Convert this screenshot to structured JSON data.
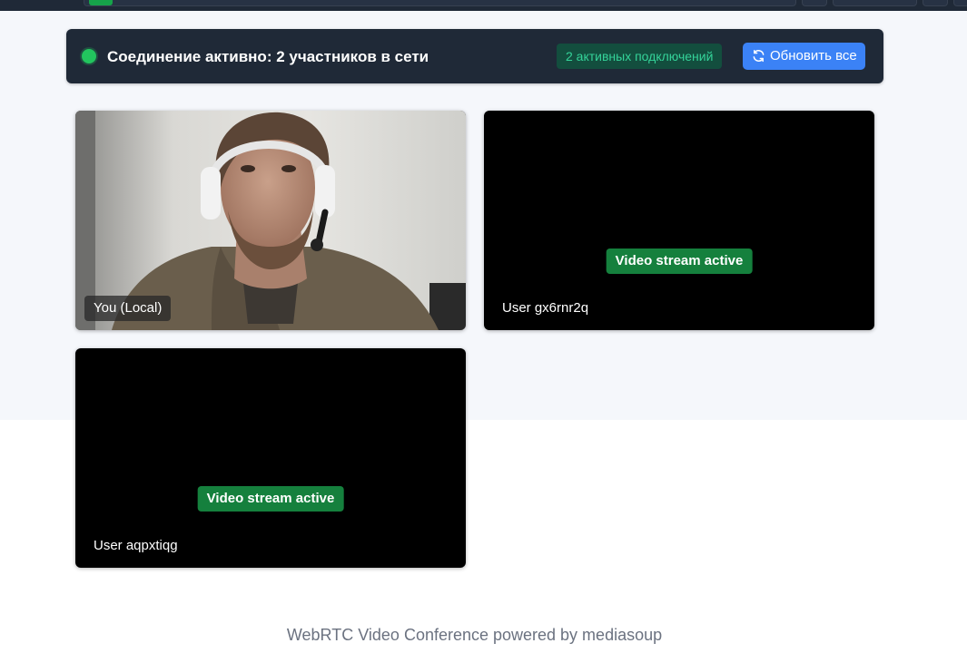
{
  "status_bar": {
    "title": "Соединение активно: 2 участников в сети",
    "connections_badge": "2 активных подключений",
    "refresh_button_label": "Обновить все",
    "refresh_icon": "refresh-icon",
    "status_color": "#22c55e"
  },
  "tiles": [
    {
      "name": "You (Local)",
      "has_video": true
    },
    {
      "name": "User gx6rnr2q",
      "badge": "Video stream active"
    },
    {
      "name": "User aqpxtiqg",
      "badge": "Video stream active"
    }
  ],
  "footer": {
    "text": "WebRTC Video Conference powered by mediasoup"
  },
  "colors": {
    "accent": "#3b82f6",
    "success": "#15803d",
    "panel": "#1f2937"
  }
}
